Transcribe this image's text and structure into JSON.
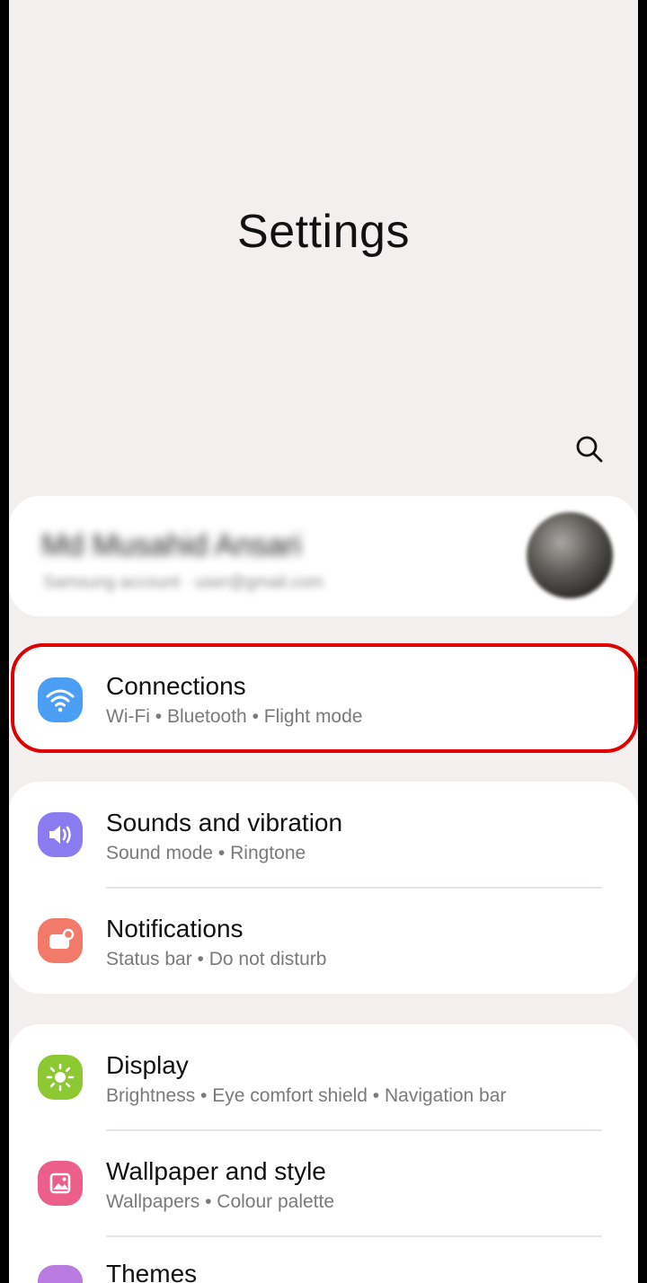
{
  "header": {
    "title": "Settings",
    "search_icon": "search-icon"
  },
  "profile": {
    "name": "Md Musahid Ansari",
    "email": "Samsung account · user@gmail.com"
  },
  "items": [
    {
      "id": "connections",
      "title": "Connections",
      "subtitle": "Wi-Fi  •  Bluetooth  •  Flight mode",
      "icon": "wifi-icon",
      "color": "#4a9ff5"
    },
    {
      "id": "sounds",
      "title": "Sounds and vibration",
      "subtitle": "Sound mode  •  Ringtone",
      "icon": "speaker-icon",
      "color": "#8a7cf0"
    },
    {
      "id": "notifications",
      "title": "Notifications",
      "subtitle": "Status bar  •  Do not disturb",
      "icon": "notification-icon",
      "color": "#f27a6a"
    },
    {
      "id": "display",
      "title": "Display",
      "subtitle": "Brightness  •  Eye comfort shield  •  Navigation bar",
      "icon": "sun-icon",
      "color": "#8bc832"
    },
    {
      "id": "wallpaper",
      "title": "Wallpaper and style",
      "subtitle": "Wallpapers  •  Colour palette",
      "icon": "image-icon",
      "color": "#ec5f8a"
    },
    {
      "id": "themes",
      "title": "Themes",
      "subtitle": "",
      "icon": "themes-icon",
      "color": "#b97be0"
    }
  ],
  "highlight_color": "#e00000"
}
